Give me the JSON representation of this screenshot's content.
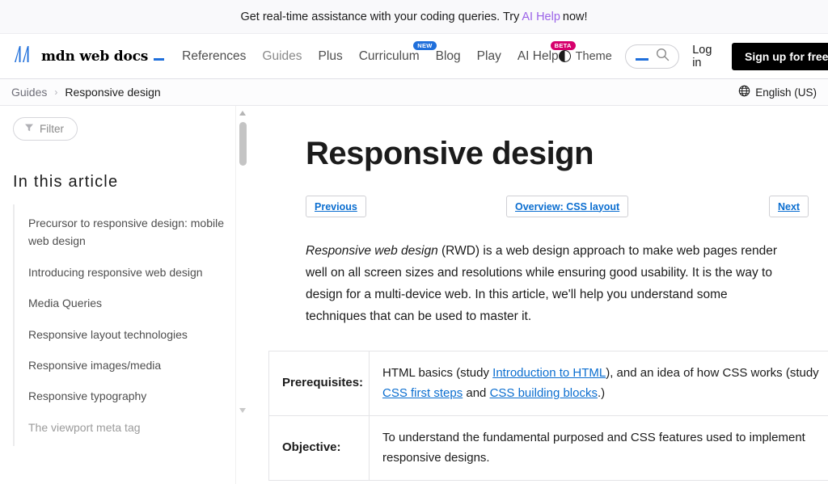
{
  "promo": {
    "text_before": "Get real-time assistance with your coding queries. Try",
    "link": "AI Help",
    "text_after": "now!"
  },
  "header": {
    "logo_text": "mdn web docs",
    "nav": [
      {
        "label": "References",
        "badge": "",
        "muted": false
      },
      {
        "label": "Guides",
        "badge": "",
        "muted": true
      },
      {
        "label": "Plus",
        "badge": "",
        "muted": false
      },
      {
        "label": "Curriculum",
        "badge": "NEW",
        "muted": false
      },
      {
        "label": "Blog",
        "badge": "",
        "muted": false
      },
      {
        "label": "Play",
        "badge": "",
        "muted": false
      },
      {
        "label": "AI Help",
        "badge": "BETA",
        "muted": false
      }
    ],
    "theme_label": "Theme",
    "search_placeholder": "",
    "search_value": "",
    "login_label": "Log in",
    "signup_label": "Sign up for free"
  },
  "breadcrumb": {
    "parent": "Guides",
    "separator": "›",
    "current": "Responsive design",
    "language": "English (US)"
  },
  "sidebar": {
    "filter_label": "Filter",
    "toc_heading": "In this article",
    "toc_items": [
      {
        "label": "Precursor to responsive design: mobile web design",
        "dim": false
      },
      {
        "label": "Introducing responsive web design",
        "dim": false
      },
      {
        "label": "Media Queries",
        "dim": false
      },
      {
        "label": "Responsive layout technologies",
        "dim": false
      },
      {
        "label": "Responsive images/media",
        "dim": false
      },
      {
        "label": "Responsive typography",
        "dim": false
      },
      {
        "label": "The viewport meta tag",
        "dim": true
      }
    ]
  },
  "article": {
    "title": "Responsive design",
    "nav_prev": "Previous",
    "nav_overview": "Overview: CSS layout",
    "nav_next": "Next",
    "lede_em": "Responsive web design",
    "lede_rest": " (RWD) is a web design approach to make web pages render well on all screen sizes and resolutions while ensuring good usability. It is the way to design for a multi-device web. In this article, we'll help you understand some techniques that can be used to master it.",
    "meta_rows": [
      {
        "label": "Prerequisites:",
        "parts": [
          {
            "t": "HTML basics (study ",
            "link": false
          },
          {
            "t": "Introduction to HTML",
            "link": true
          },
          {
            "t": "), and an idea of how CSS works (study ",
            "link": false
          },
          {
            "t": "CSS first steps",
            "link": true
          },
          {
            "t": " and ",
            "link": false
          },
          {
            "t": "CSS building blocks",
            "link": true
          },
          {
            "t": ".)",
            "link": false
          }
        ]
      },
      {
        "label": "Objective:",
        "parts": [
          {
            "t": "To understand the fundamental purposed and CSS features used to implement responsive designs.",
            "link": false
          }
        ]
      }
    ]
  },
  "colors": {
    "accent_blue": "#1f6fdb",
    "link_blue": "#0b6ed0",
    "promo_purple": "#9b62e8",
    "badge_new": "#1f6fdb",
    "badge_beta": "#d6006c",
    "signup_bg": "#000000"
  }
}
